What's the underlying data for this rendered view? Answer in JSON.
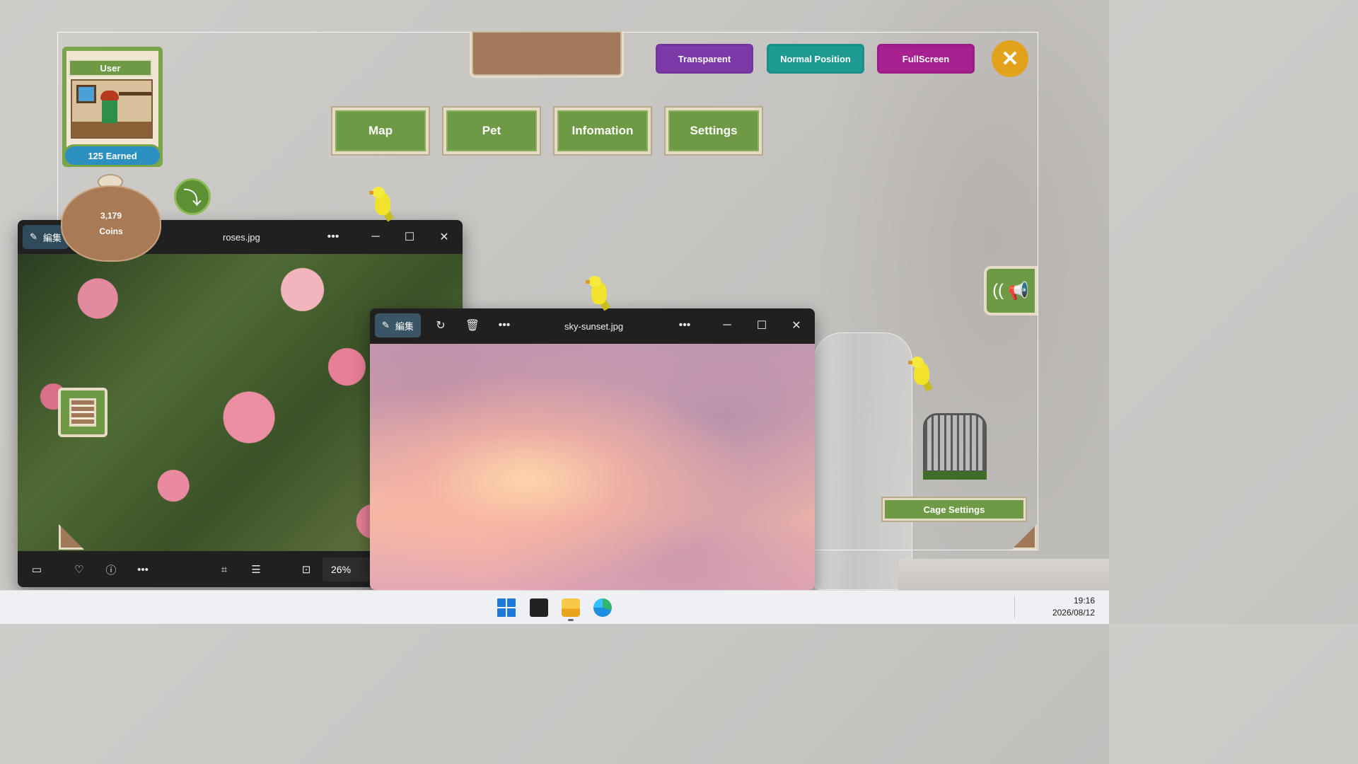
{
  "overlay": {
    "top_buttons": {
      "transparent": "Transparent",
      "normal_position": "Normal Position",
      "fullscreen": "FullScreen",
      "close_glyph": "✕"
    },
    "nav": {
      "map": "Map",
      "pet": "Pet",
      "information": "Infomation",
      "settings": "Settings"
    },
    "user": {
      "title": "User",
      "earned": "125 Earned"
    },
    "coins": {
      "amount": "3,179",
      "label": "Coins"
    },
    "cage_settings": "Cage Settings",
    "icons": {
      "arrow": "arrow-turn-icon",
      "list": "scroll-list-icon",
      "sound": "megaphone-icon"
    }
  },
  "windows": [
    {
      "file_name": "roses.jpg",
      "edit_label": "編集",
      "zoom": "26%"
    },
    {
      "file_name": "sky-sunset.jpg",
      "edit_label": "編集"
    }
  ],
  "taskbar": {
    "time": "19:16",
    "date": "2026/08/12",
    "apps": [
      "start",
      "task-view",
      "file-explorer",
      "edge"
    ]
  },
  "colors": {
    "nav_green": "#6f9a45",
    "transparent_purple": "#7b3aa8",
    "normal_teal": "#1d9b93",
    "fullscreen_magenta": "#a81f90",
    "close_gold": "#e2a21b"
  }
}
